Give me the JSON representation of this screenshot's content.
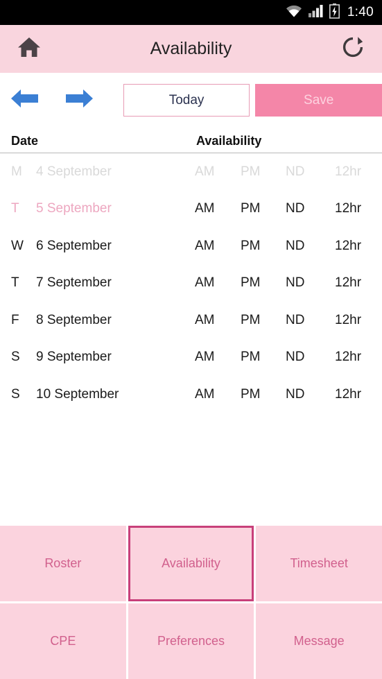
{
  "statusbar": {
    "time": "1:40",
    "icons": [
      "wifi-icon",
      "cell-signal-icon",
      "battery-charging-icon"
    ]
  },
  "titlebar": {
    "home_icon": "home-icon",
    "title": "Availability",
    "refresh_icon": "refresh-icon",
    "background_color": "#f9d5de"
  },
  "toolbar": {
    "prev_icon": "arrow-left-icon",
    "next_icon": "arrow-right-icon",
    "today_label": "Today",
    "save_label": "Save",
    "today_border_color": "#e79bb5",
    "save_background_color": "#f486a8",
    "save_text_color": "#fdd3e0",
    "arrow_color": "#3b7fd4"
  },
  "table": {
    "headers": {
      "date": "Date",
      "availability": "Availability"
    },
    "slot_labels": [
      "AM",
      "PM",
      "ND",
      "12hr"
    ],
    "rows": [
      {
        "dow": "M",
        "date": "4 September",
        "state": "disabled",
        "slots": [
          "AM",
          "PM",
          "ND",
          "12hr"
        ]
      },
      {
        "dow": "T",
        "date": "5 September",
        "state": "highlight",
        "slots": [
          "AM",
          "PM",
          "ND",
          "12hr"
        ]
      },
      {
        "dow": "W",
        "date": "6 September",
        "state": "normal",
        "slots": [
          "AM",
          "PM",
          "ND",
          "12hr"
        ]
      },
      {
        "dow": "T",
        "date": "7 September",
        "state": "normal",
        "slots": [
          "AM",
          "PM",
          "ND",
          "12hr"
        ]
      },
      {
        "dow": "F",
        "date": "8 September",
        "state": "normal",
        "slots": [
          "AM",
          "PM",
          "ND",
          "12hr"
        ]
      },
      {
        "dow": "S",
        "date": "9 September",
        "state": "normal",
        "slots": [
          "AM",
          "PM",
          "ND",
          "12hr"
        ]
      },
      {
        "dow": "S",
        "date": "10 September",
        "state": "normal",
        "slots": [
          "AM",
          "PM",
          "ND",
          "12hr"
        ]
      }
    ]
  },
  "bottomnav": {
    "background_color": "#fbd3de",
    "text_color": "#d1608d",
    "active_border_color": "#c8407a",
    "items": [
      {
        "label": "Roster",
        "active": false
      },
      {
        "label": "Availability",
        "active": true
      },
      {
        "label": "Timesheet",
        "active": false
      },
      {
        "label": "CPE",
        "active": false
      },
      {
        "label": "Preferences",
        "active": false
      },
      {
        "label": "Message",
        "active": false
      }
    ]
  }
}
